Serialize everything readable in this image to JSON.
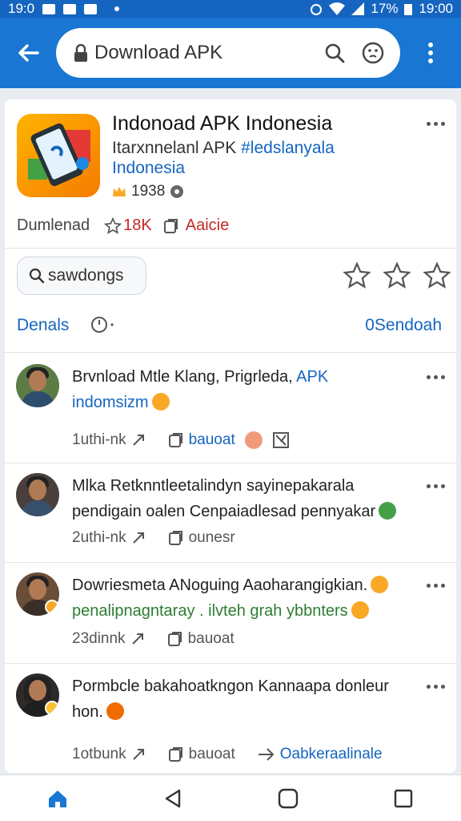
{
  "status_bar": {
    "time_left": "19:0",
    "battery": "17%",
    "time_right": "19:00"
  },
  "browser": {
    "url": "Download APK"
  },
  "app": {
    "title": "Indonoad APK Indonesia",
    "subtitle_prefix": "Itarxnnelanl APK ",
    "subtitle_hashtag": "#ledslanyala",
    "subtitle_line2": "Indonesia",
    "rating_icon": "crown-icon",
    "rating_count": "1938",
    "downloads_label": "Dumlenad",
    "star_count": "18K",
    "tag": "Aaicie"
  },
  "actions": {
    "chip_label": "sawdongs",
    "details_label": "Denals",
    "send_label": "0Sendoah"
  },
  "comments": [
    {
      "title": "Brvnload Mtle Klang, Prigrleda, ",
      "title_link": "APK",
      "body": "indomsizm",
      "body_class": "blue",
      "emoji_color": "#f9a825",
      "time": "1uthi-nk",
      "tag": "bauoat",
      "extra": "",
      "has_reaction": true
    },
    {
      "title": "Mlka Retknntleetalindyn sayinepakarala",
      "title_link": "",
      "body": "pendigain oalen Cenpaiadlesad pennyakar",
      "body_class": "",
      "emoji_color": "#43a047",
      "time": "2uthi-nk",
      "tag": "ounesr",
      "extra": "",
      "has_reaction": false
    },
    {
      "title": "Dowriesmeta ANoguing Aaoharangigkian.",
      "title_link": "",
      "body": "penalipnagntaray . ilvteh grah ybbnters",
      "body_class": "green",
      "emoji_color": "#f9a825",
      "time": "23dinnk",
      "tag": "bauoat",
      "extra": "",
      "has_reaction": false
    },
    {
      "title": "Pormbcle bakahoatkngon Kannaapa donleur",
      "title_link": "",
      "body": "hon.",
      "body_class": "",
      "emoji_color": "#ef6c00",
      "time": "1otbunk",
      "tag": "bauoat",
      "extra": "Oabkeraalinale",
      "has_reaction": false
    }
  ],
  "colors": {
    "primary": "#1976d2",
    "link": "#1565c0",
    "accent_red": "#c62828"
  }
}
